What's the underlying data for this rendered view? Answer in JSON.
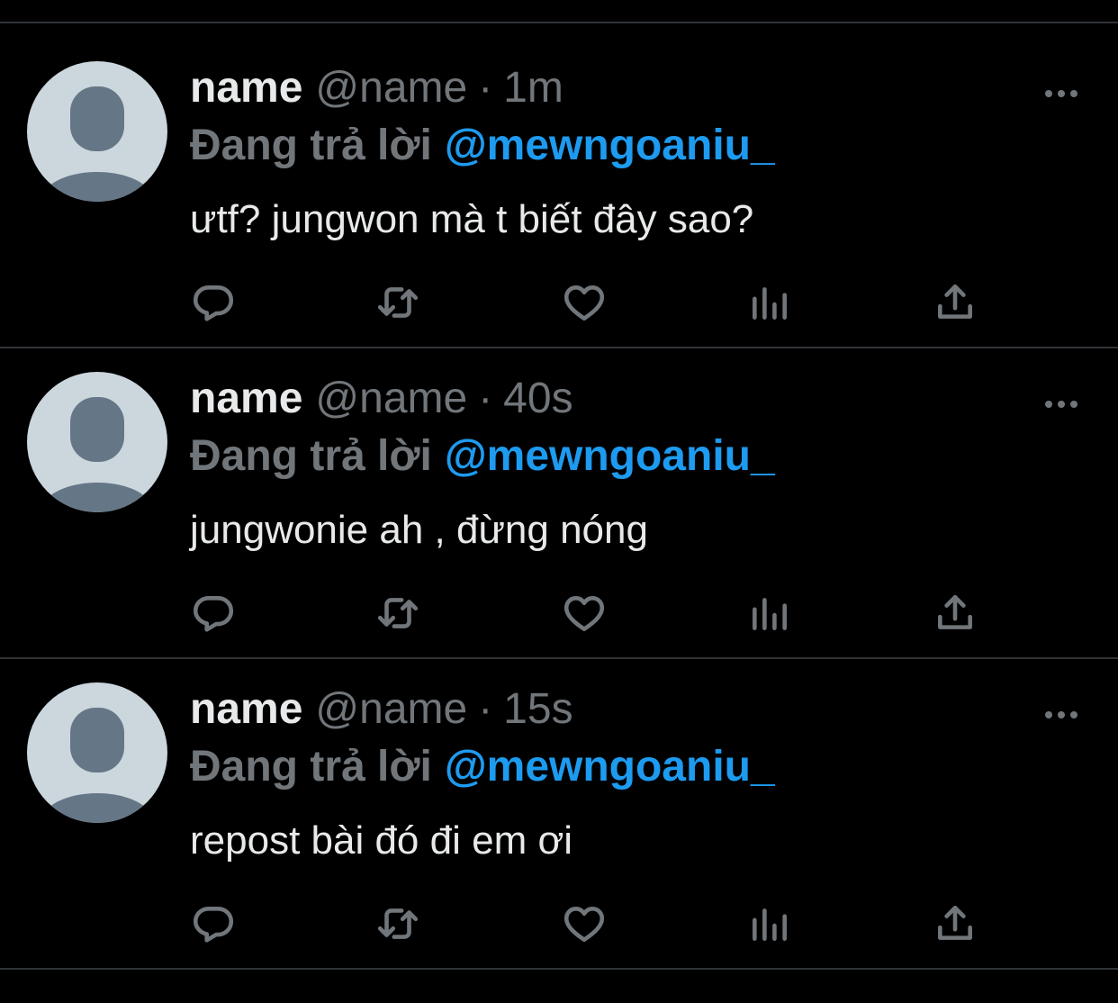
{
  "colors": {
    "background": "#000000",
    "text_primary": "#e7e9ea",
    "text_secondary": "#71767b",
    "accent": "#1d9bf0",
    "divider": "#2f3336",
    "avatar_bg": "#ccd6dd",
    "avatar_figure": "#657786"
  },
  "icons": {
    "reply": "reply-icon",
    "retweet": "retweet-icon",
    "like": "heart-icon",
    "views": "analytics-icon",
    "share": "share-icon",
    "more": "more-icon",
    "avatar": "default-avatar-icon"
  },
  "tweets": [
    {
      "display_name": "name",
      "handle": "@name",
      "separator": "·",
      "time": "1m",
      "reply_prefix": "Đang trả lời",
      "reply_mention": "@mewngoaniu_",
      "text": "ưtf? jungwon mà t biết đây sao?"
    },
    {
      "display_name": "name",
      "handle": "@name",
      "separator": "·",
      "time": "40s",
      "reply_prefix": "Đang trả lời",
      "reply_mention": "@mewngoaniu_",
      "text": "jungwonie ah , đừng nóng"
    },
    {
      "display_name": "name",
      "handle": "@name",
      "separator": "·",
      "time": "15s",
      "reply_prefix": "Đang trả lời",
      "reply_mention": "@mewngoaniu_",
      "text": "repost bài đó đi em ơi"
    }
  ]
}
